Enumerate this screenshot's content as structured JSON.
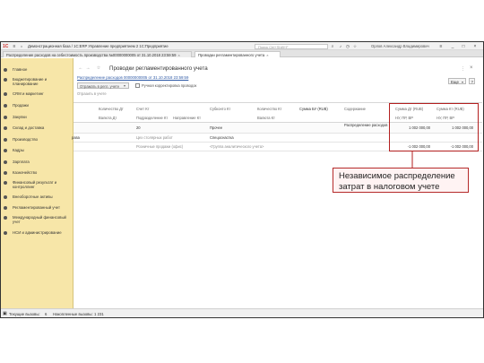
{
  "app": {
    "title": "Демонстрационная база / 1С:ERP Управление предприятием 2 1С:Предприятие",
    "search_placeholder": "Поиск Ctrl+Shift+F",
    "user": "Орлов Александр Владимирович"
  },
  "tabs": [
    {
      "label": "Распределение расходов на себестоимость производства №00000000005 от 31.10.2018 23:59:59"
    },
    {
      "label": "Проводки регламентированного учета"
    }
  ],
  "sidebar": {
    "items": [
      {
        "label": "Главное",
        "icon": "home-icon"
      },
      {
        "label": "Бюджетирование и планирование",
        "icon": "budget-icon"
      },
      {
        "label": "CRM и маркетинг",
        "icon": "crm-icon"
      },
      {
        "label": "Продажи",
        "icon": "sales-icon"
      },
      {
        "label": "Закупки",
        "icon": "purchases-icon"
      },
      {
        "label": "Склад и доставка",
        "icon": "warehouse-icon"
      },
      {
        "label": "Производство",
        "icon": "production-icon"
      },
      {
        "label": "Кадры",
        "icon": "personnel-icon"
      },
      {
        "label": "Зарплата",
        "icon": "salary-icon"
      },
      {
        "label": "Казначейство",
        "icon": "treasury-icon"
      },
      {
        "label": "Финансовый результат и контроллинг",
        "icon": "finance-icon"
      },
      {
        "label": "Внеоборотные активы",
        "icon": "assets-icon"
      },
      {
        "label": "Регламентированный учет",
        "icon": "accounting-icon"
      },
      {
        "label": "Международный финансовый учет",
        "icon": "ifrs-icon"
      },
      {
        "label": "НСИ и администрирование",
        "icon": "admin-icon"
      }
    ]
  },
  "form": {
    "title": "Проводки регламентированного учета",
    "breadcrumb": "Распределение расходов 00000000005 от 31.10.2018 23:59:59",
    "dropdown_label": "Отражать в регл. учете",
    "checkbox_label": "Ручная корректировка проводок",
    "section_label": "Отразить в учете",
    "more_label": "Еще",
    "help_label": "?"
  },
  "table": {
    "header_row1": [
      "Количество Дт",
      "Счет Кт",
      "Субконто Кт",
      "Количество Кт",
      "Сумма БУ (RUB)",
      "Содержание",
      "Сумма Дт (RUB)",
      "Сумма Кт (RUB)"
    ],
    "header_row2": [
      "Валюта Дт",
      "Подразделение Кт",
      "Направление Кт",
      "Валюта Кт",
      "НУ, ПР, ВР",
      "НУ, ПР, ВР"
    ],
    "rows": [
      {
        "account_kt": "20",
        "subconto_kt": "Прочее",
        "content": "Распределение расходов",
        "sum_dt": "1 002 000,00",
        "sum_kt": "1 002 000,00"
      },
      {
        "label": "рава",
        "dept_kt": "Цех столярных работ",
        "subconto_kt": "Спецоснастка",
        "sum_dt": "",
        "sum_kt": ""
      },
      {
        "label": "",
        "dept_kt": "Розничные продажи (офис)",
        "subconto_kt": "<Группа аналитического учета>",
        "sum_dt": "-1 002 000,00",
        "sum_kt": "-1 002 000,00"
      }
    ]
  },
  "status": {
    "current_calls_label": "Текущие вызовы:",
    "current_calls_value": "6",
    "accum_calls_label": "Накопленные вызовы:",
    "accum_calls_value": "1 231"
  },
  "callout": {
    "line1": "Независимое распределение",
    "line2": "затрат в налоговом учете"
  },
  "colors": {
    "sidebar_bg": "#f7e6a8",
    "highlight": "#b31f1f",
    "callout_border": "#b52a2a",
    "callout_bg": "#fff3f3"
  }
}
